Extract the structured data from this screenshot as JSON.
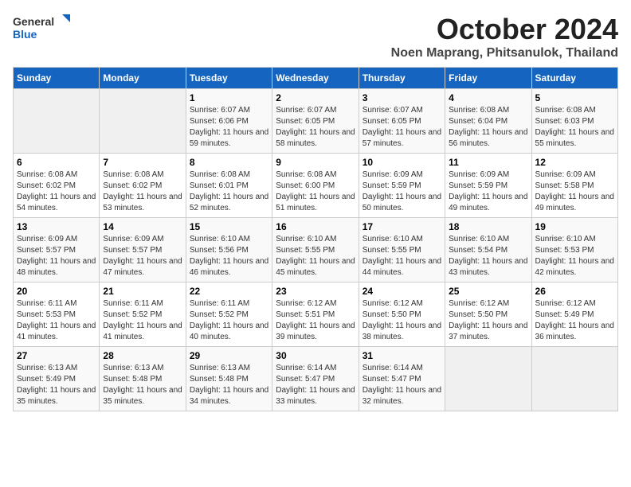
{
  "header": {
    "logo_general": "General",
    "logo_blue": "Blue",
    "month_title": "October 2024",
    "location": "Noen Maprang, Phitsanulok, Thailand"
  },
  "weekdays": [
    "Sunday",
    "Monday",
    "Tuesday",
    "Wednesday",
    "Thursday",
    "Friday",
    "Saturday"
  ],
  "weeks": [
    [
      {
        "day": "",
        "info": ""
      },
      {
        "day": "",
        "info": ""
      },
      {
        "day": "1",
        "info": "Sunrise: 6:07 AM\nSunset: 6:06 PM\nDaylight: 11 hours and 59 minutes."
      },
      {
        "day": "2",
        "info": "Sunrise: 6:07 AM\nSunset: 6:05 PM\nDaylight: 11 hours and 58 minutes."
      },
      {
        "day": "3",
        "info": "Sunrise: 6:07 AM\nSunset: 6:05 PM\nDaylight: 11 hours and 57 minutes."
      },
      {
        "day": "4",
        "info": "Sunrise: 6:08 AM\nSunset: 6:04 PM\nDaylight: 11 hours and 56 minutes."
      },
      {
        "day": "5",
        "info": "Sunrise: 6:08 AM\nSunset: 6:03 PM\nDaylight: 11 hours and 55 minutes."
      }
    ],
    [
      {
        "day": "6",
        "info": "Sunrise: 6:08 AM\nSunset: 6:02 PM\nDaylight: 11 hours and 54 minutes."
      },
      {
        "day": "7",
        "info": "Sunrise: 6:08 AM\nSunset: 6:02 PM\nDaylight: 11 hours and 53 minutes."
      },
      {
        "day": "8",
        "info": "Sunrise: 6:08 AM\nSunset: 6:01 PM\nDaylight: 11 hours and 52 minutes."
      },
      {
        "day": "9",
        "info": "Sunrise: 6:08 AM\nSunset: 6:00 PM\nDaylight: 11 hours and 51 minutes."
      },
      {
        "day": "10",
        "info": "Sunrise: 6:09 AM\nSunset: 5:59 PM\nDaylight: 11 hours and 50 minutes."
      },
      {
        "day": "11",
        "info": "Sunrise: 6:09 AM\nSunset: 5:59 PM\nDaylight: 11 hours and 49 minutes."
      },
      {
        "day": "12",
        "info": "Sunrise: 6:09 AM\nSunset: 5:58 PM\nDaylight: 11 hours and 49 minutes."
      }
    ],
    [
      {
        "day": "13",
        "info": "Sunrise: 6:09 AM\nSunset: 5:57 PM\nDaylight: 11 hours and 48 minutes."
      },
      {
        "day": "14",
        "info": "Sunrise: 6:09 AM\nSunset: 5:57 PM\nDaylight: 11 hours and 47 minutes."
      },
      {
        "day": "15",
        "info": "Sunrise: 6:10 AM\nSunset: 5:56 PM\nDaylight: 11 hours and 46 minutes."
      },
      {
        "day": "16",
        "info": "Sunrise: 6:10 AM\nSunset: 5:55 PM\nDaylight: 11 hours and 45 minutes."
      },
      {
        "day": "17",
        "info": "Sunrise: 6:10 AM\nSunset: 5:55 PM\nDaylight: 11 hours and 44 minutes."
      },
      {
        "day": "18",
        "info": "Sunrise: 6:10 AM\nSunset: 5:54 PM\nDaylight: 11 hours and 43 minutes."
      },
      {
        "day": "19",
        "info": "Sunrise: 6:10 AM\nSunset: 5:53 PM\nDaylight: 11 hours and 42 minutes."
      }
    ],
    [
      {
        "day": "20",
        "info": "Sunrise: 6:11 AM\nSunset: 5:53 PM\nDaylight: 11 hours and 41 minutes."
      },
      {
        "day": "21",
        "info": "Sunrise: 6:11 AM\nSunset: 5:52 PM\nDaylight: 11 hours and 41 minutes."
      },
      {
        "day": "22",
        "info": "Sunrise: 6:11 AM\nSunset: 5:52 PM\nDaylight: 11 hours and 40 minutes."
      },
      {
        "day": "23",
        "info": "Sunrise: 6:12 AM\nSunset: 5:51 PM\nDaylight: 11 hours and 39 minutes."
      },
      {
        "day": "24",
        "info": "Sunrise: 6:12 AM\nSunset: 5:50 PM\nDaylight: 11 hours and 38 minutes."
      },
      {
        "day": "25",
        "info": "Sunrise: 6:12 AM\nSunset: 5:50 PM\nDaylight: 11 hours and 37 minutes."
      },
      {
        "day": "26",
        "info": "Sunrise: 6:12 AM\nSunset: 5:49 PM\nDaylight: 11 hours and 36 minutes."
      }
    ],
    [
      {
        "day": "27",
        "info": "Sunrise: 6:13 AM\nSunset: 5:49 PM\nDaylight: 11 hours and 35 minutes."
      },
      {
        "day": "28",
        "info": "Sunrise: 6:13 AM\nSunset: 5:48 PM\nDaylight: 11 hours and 35 minutes."
      },
      {
        "day": "29",
        "info": "Sunrise: 6:13 AM\nSunset: 5:48 PM\nDaylight: 11 hours and 34 minutes."
      },
      {
        "day": "30",
        "info": "Sunrise: 6:14 AM\nSunset: 5:47 PM\nDaylight: 11 hours and 33 minutes."
      },
      {
        "day": "31",
        "info": "Sunrise: 6:14 AM\nSunset: 5:47 PM\nDaylight: 11 hours and 32 minutes."
      },
      {
        "day": "",
        "info": ""
      },
      {
        "day": "",
        "info": ""
      }
    ]
  ]
}
